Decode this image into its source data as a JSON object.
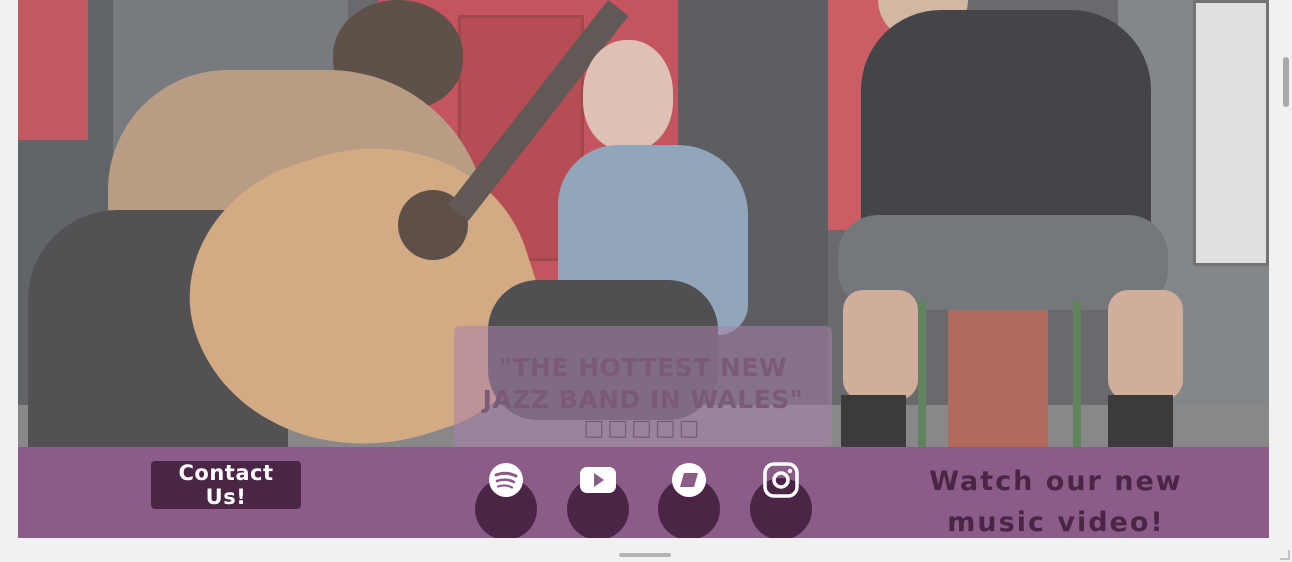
{
  "hero": {
    "quote": "\"THE HOTTEST NEW JAZZ BAND IN WALES\"",
    "rating_stars": "□□□□□"
  },
  "footer": {
    "contact_label": "Contact Us!",
    "watch_text": "Watch our new music video!",
    "social_links": [
      {
        "name": "spotify",
        "icon": "spotify-icon"
      },
      {
        "name": "youtube",
        "icon": "youtube-icon"
      },
      {
        "name": "bandcamp",
        "icon": "bandcamp-icon"
      },
      {
        "name": "instagram",
        "icon": "instagram-icon"
      }
    ]
  },
  "colors": {
    "footer_bg": "#8c5c88",
    "accent_dark": "#4a2545",
    "quote_overlay": "#aa82aa"
  }
}
